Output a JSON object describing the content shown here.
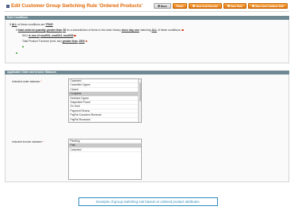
{
  "header": {
    "title": "Edit Customer Group Switching Rule 'Ordered Products'",
    "buttons": [
      "Back",
      "Reset",
      "Save And Execute",
      "Save Rule",
      "Save And Continue Edit"
    ]
  },
  "conditions": {
    "section_title": "Rule Conditions",
    "line1": {
      "pre": "If",
      "all": "ALL",
      "mid": "of these conditions are",
      "val": "TRUE",
      "post": ":"
    },
    "line2": {
      "pre": "If",
      "attr": "total ordered quantity",
      "op": "greater than",
      "val": "28",
      "mid": "for a subselection of items in the order history",
      "period": "since day one",
      "match": "matching",
      "all": "ALL",
      "post": "of these conditions:"
    },
    "line3": {
      "pre": "SKU",
      "op": "is one of",
      "val": "msd001, msd004, msd005"
    },
    "line4": {
      "pre": "Total Product Turnover (excl. tax)",
      "op": "greater than",
      "val": "1500"
    }
  },
  "statuses": {
    "section_title": "Applicable Order and Invoice Statuses",
    "order_label": "Included order statuses",
    "order_options": [
      "Canceled",
      "Cancelled Ogone",
      "Closed",
      "Complete",
      "Declined Ogone",
      "Suspected Fraud",
      "On Hold",
      "Payment Review",
      "PayPal Canceled Reversal",
      "PayPal Reversed"
    ],
    "order_selected": 3,
    "invoice_label": "Included invoice statuses",
    "invoice_options": [
      "Pending",
      "Paid",
      "Canceled"
    ],
    "invoice_selected": 1
  },
  "caption": "Example of group switching rule based on ordered product attributes.",
  "colors": {
    "accent": "#e26703",
    "section_header": "#6f8992",
    "caption_border": "#2e8bbf"
  }
}
